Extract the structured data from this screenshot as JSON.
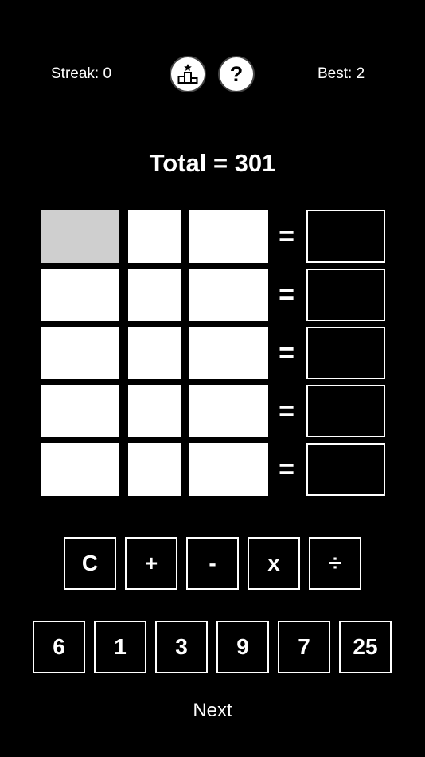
{
  "header": {
    "streak": "Streak: 0",
    "best": "Best: 2",
    "help_label": "?"
  },
  "total": "Total = 301",
  "equals_sign": "=",
  "grid": {
    "rows": 5,
    "active_cell": {
      "row": 1,
      "col": 1
    }
  },
  "operators": [
    "C",
    "+",
    "-",
    "x",
    "÷"
  ],
  "numbers": [
    "6",
    "1",
    "3",
    "9",
    "7",
    "25"
  ],
  "next_label": "Next",
  "colors": {
    "background": "#000000",
    "foreground": "#ffffff",
    "active_cell": "#cfcfcf"
  }
}
